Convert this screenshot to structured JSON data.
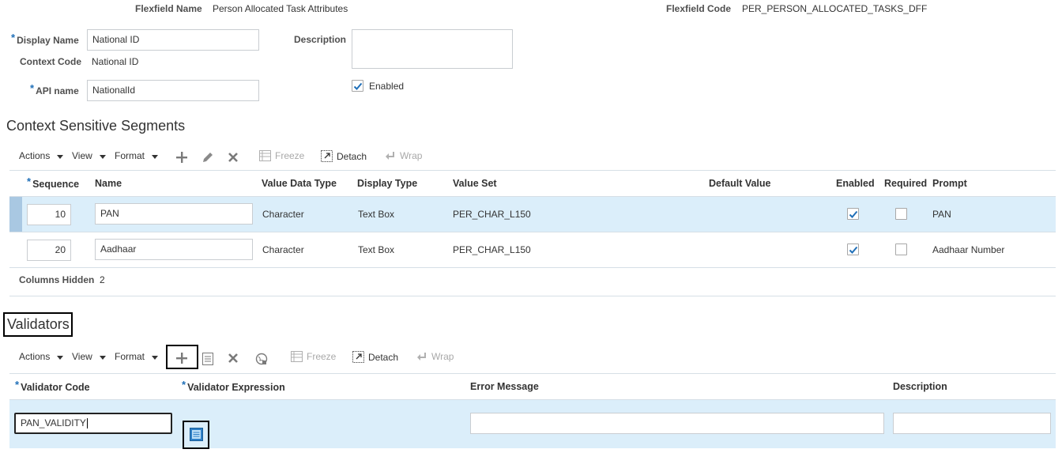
{
  "header": {
    "flexfield_name_label": "Flexfield Name",
    "flexfield_name_value": "Person Allocated Task Attributes",
    "flexfield_code_label": "Flexfield Code",
    "flexfield_code_value": "PER_PERSON_ALLOCATED_TASKS_DFF"
  },
  "context": {
    "display_name_label": "Display Name",
    "display_name_value": "National ID",
    "context_code_label": "Context Code",
    "context_code_value": "National ID",
    "api_name_label": "API name",
    "api_name_value": "NationalId",
    "description_label": "Description",
    "description_value": "",
    "enabled_label": "Enabled",
    "enabled_checked": true
  },
  "segments": {
    "title": "Context Sensitive Segments",
    "toolbar": {
      "actions": "Actions",
      "view": "View",
      "format": "Format",
      "freeze": "Freeze",
      "detach": "Detach",
      "wrap": "Wrap"
    },
    "columns": {
      "sequence": "Sequence",
      "name": "Name",
      "value_data_type": "Value Data Type",
      "display_type": "Display Type",
      "value_set": "Value Set",
      "default_value": "Default Value",
      "enabled": "Enabled",
      "required": "Required",
      "prompt": "Prompt"
    },
    "rows": [
      {
        "sequence": "10",
        "name": "PAN",
        "value_data_type": "Character",
        "display_type": "Text Box",
        "value_set": "PER_CHAR_L150",
        "default_value": "",
        "enabled": true,
        "required": false,
        "prompt": "PAN"
      },
      {
        "sequence": "20",
        "name": "Aadhaar",
        "value_data_type": "Character",
        "display_type": "Text Box",
        "value_set": "PER_CHAR_L150",
        "default_value": "",
        "enabled": true,
        "required": false,
        "prompt": "Aadhaar Number"
      }
    ],
    "columns_hidden_label": "Columns Hidden",
    "columns_hidden_value": "2"
  },
  "validators": {
    "title": "Validators",
    "toolbar": {
      "actions": "Actions",
      "view": "View",
      "format": "Format",
      "freeze": "Freeze",
      "detach": "Detach",
      "wrap": "Wrap"
    },
    "columns": {
      "validator_code": "Validator Code",
      "validator_expression": "Validator Expression",
      "error_message": "Error Message",
      "description": "Description"
    },
    "rows": [
      {
        "validator_code": "PAN_VALIDITY",
        "error_message": "",
        "description": ""
      }
    ]
  },
  "colors": {
    "selected_row": "#dbeefa",
    "row_marker": "#a9c8e2",
    "required_star": "#1f6fb8",
    "check": "#1f6fb8"
  },
  "icons": [
    "add-icon",
    "edit-icon",
    "delete-icon",
    "freeze-icon",
    "detach-icon",
    "wrap-icon",
    "list-icon",
    "globe-icon",
    "expression-editor-icon",
    "checkmark-icon",
    "caret-down-icon"
  ]
}
